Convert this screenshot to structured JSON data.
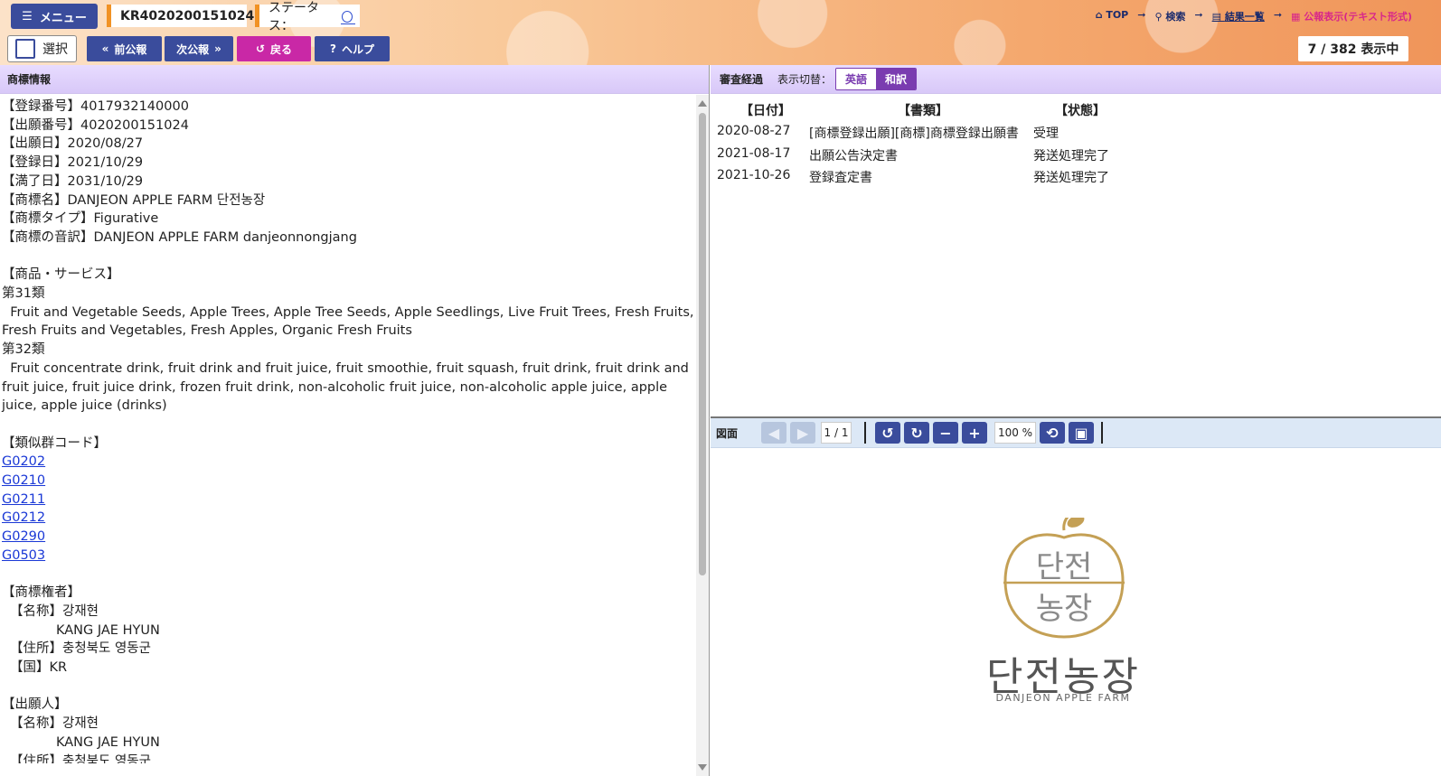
{
  "header": {
    "menu_label": "メニュー",
    "app_number": "KR4020200151024",
    "status_label": "ステータス：",
    "nav": {
      "top": "TOP",
      "search": "検索",
      "results": "結果一覧",
      "publication": "公報表示(テキスト形式)"
    },
    "select_label": "選択",
    "prev_label": "前公報",
    "next_label": "次公報",
    "back_label": "戻る",
    "help_label": "ヘルプ",
    "count_text": "7 / 382 表示中"
  },
  "left": {
    "title": "商標情報",
    "fields": [
      "【登録番号】4017932140000",
      "【出願番号】4020200151024",
      "【出願日】2020/08/27",
      "【登録日】2021/10/29",
      "【満了日】2031/10/29",
      "【商標名】DANJEON APPLE FARM 단전농장",
      "【商標タイプ】Figurative",
      "【商標の音訳】DANJEON APPLE FARM danjeonnongjang"
    ],
    "goods_heading": "【商品・サービス】",
    "class31_heading": "第31類",
    "class31_text": "Fruit and Vegetable Seeds, Apple Trees, Apple Tree Seeds, Apple Seedlings, Live Fruit Trees, Fresh Fruits, Fresh Fruits and Vegetables, Fresh Apples, Organic Fresh Fruits",
    "class32_heading": "第32類",
    "class32_text": "Fruit concentrate drink, fruit drink and fruit juice, fruit smoothie, fruit squash, fruit drink, fruit drink and fruit juice, fruit juice drink, frozen fruit drink, non-alcoholic fruit juice, non-alcoholic apple juice, apple juice, apple juice (drinks)",
    "similar_heading": "【類似群コード】",
    "similar_codes": [
      "G0202",
      "G0210",
      "G0211",
      "G0212",
      "G0290",
      "G0503"
    ],
    "owner_heading": "【商標権者】",
    "owner_name_label": "【名称】강재현",
    "owner_name_en": "KANG JAE HYUN",
    "owner_address": "【住所】충청북도 영동군",
    "owner_country": "【国】KR",
    "applicant_heading": "【出願人】",
    "applicant_name_label": "【名称】강재현",
    "applicant_name_en": "KANG JAE HYUN",
    "applicant_address": "【住所】충청북도 영동군"
  },
  "history": {
    "title": "審査経過",
    "toggle_label": "表示切替：",
    "toggle_options": [
      "英語",
      "和訳"
    ],
    "headers": [
      "【日付】",
      "【書類】",
      "【状態】"
    ],
    "rows": [
      {
        "date": "2020-08-27",
        "doc": "[商標登録出願][商標]商標登録出願書",
        "status": "受理"
      },
      {
        "date": "2021-08-17",
        "doc": "出願公告決定書",
        "status": "発送処理完了"
      },
      {
        "date": "2021-10-26",
        "doc": "登録査定書",
        "status": "発送処理完了"
      }
    ]
  },
  "figure": {
    "title": "図面",
    "page": "1 / 1",
    "zoom": "100 %",
    "logo_ko": "단전농장",
    "logo_en": "DANJEON APPLE FARM",
    "logo_inner_top": "단전",
    "logo_inner_bottom": "농장",
    "logo_color": "#c4a055"
  }
}
